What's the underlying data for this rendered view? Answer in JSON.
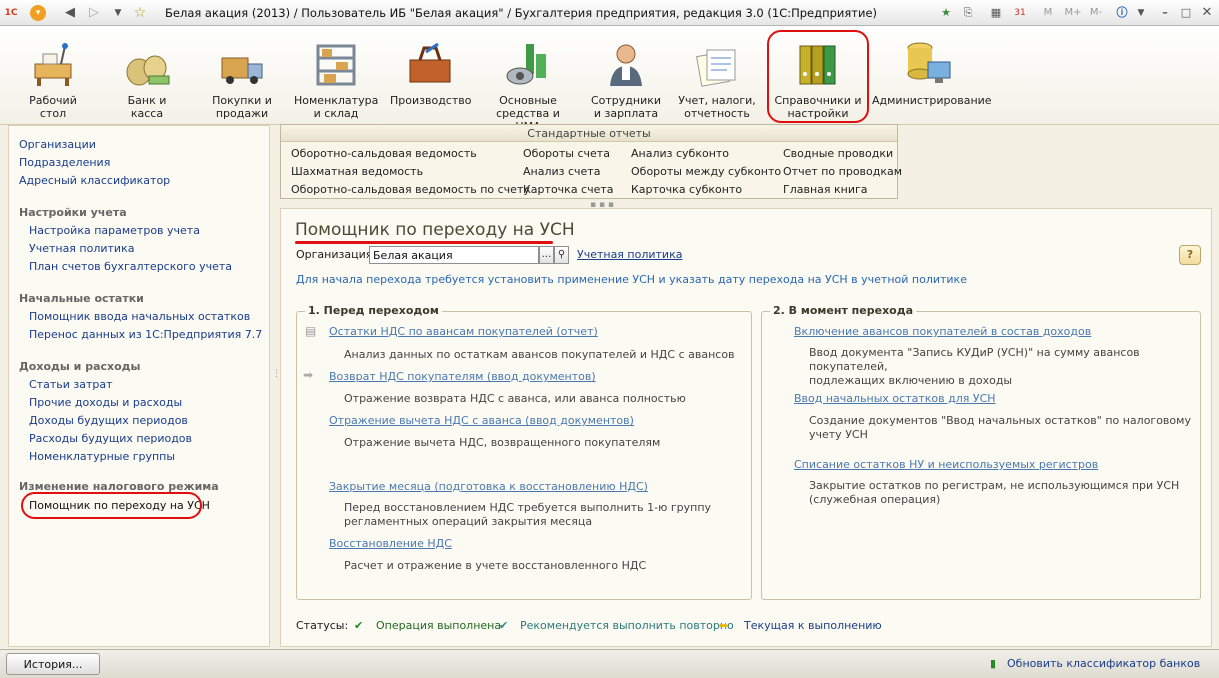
{
  "window": {
    "title": "Белая акация (2013) / Пользователь ИБ \"Белая акация\" / Бухгалтерия предприятия, редакция 3.0  (1С:Предприятие)",
    "tb_buttons": [
      "M",
      "M+",
      "M-"
    ]
  },
  "sections": [
    {
      "label": "Рабочий\nстол",
      "icon": "desk-icon"
    },
    {
      "label": "Банк и\nкасса",
      "icon": "money-bags-icon"
    },
    {
      "label": "Покупки и\nпродажи",
      "icon": "truck-icon"
    },
    {
      "label": "Номенклатура\nи склад",
      "icon": "shelves-icon"
    },
    {
      "label": "Производство",
      "icon": "toolbox-icon"
    },
    {
      "label": "Основные\nсредства и НМА",
      "icon": "factory-icon"
    },
    {
      "label": "Сотрудники\nи зарплата",
      "icon": "employee-icon"
    },
    {
      "label": "Учет, налоги,\nотчетность",
      "icon": "papers-icon"
    },
    {
      "label": "Справочники и\nнастройки учета",
      "icon": "binders-icon"
    },
    {
      "label": "Администрирование",
      "icon": "database-computer-icon"
    }
  ],
  "nav": {
    "top_links": [
      "Организации",
      "Подразделения",
      "Адресный классификатор"
    ],
    "groups": [
      {
        "title": "Настройки учета",
        "items": [
          "Настройка параметров учета",
          "Учетная политика",
          "План счетов бухгалтерского учета"
        ]
      },
      {
        "title": "Начальные остатки",
        "items": [
          "Помощник ввода начальных остатков",
          "Перенос данных из 1С:Предприятия 7.7"
        ]
      },
      {
        "title": "Доходы и расходы",
        "items": [
          "Статьи затрат",
          "Прочие доходы и расходы",
          "Доходы будущих периодов",
          "Расходы будущих периодов",
          "Номенклатурные группы"
        ]
      },
      {
        "title": "Изменение налогового режима",
        "items": [
          "Помощник по переходу на УСН"
        ]
      }
    ]
  },
  "reports": {
    "title": "Стандартные отчеты",
    "columns": [
      [
        "Оборотно-сальдовая ведомость",
        "Шахматная ведомость",
        "Оборотно-сальдовая ведомость по счету"
      ],
      [
        "Обороты счета",
        "Анализ счета",
        "Карточка счета"
      ],
      [
        "Анализ субконто",
        "Обороты между субконто",
        "Карточка субконто"
      ],
      [
        "Сводные проводки",
        "Отчет по проводкам",
        "Главная книга"
      ]
    ]
  },
  "form": {
    "title": "Помощник по переходу на УСН",
    "org_label": "Организация:",
    "org_value": "Белая акация",
    "policy_link": "Учетная политика",
    "hint": "Для начала перехода требуется установить применение УСН и указать дату перехода на УСН в учетной политике",
    "group1": {
      "title": "1. Перед переходом",
      "steps": [
        {
          "link": "Остатки НДС по авансам покупателей (отчет)",
          "desc": "Анализ данных по остаткам авансов покупателей и НДС с авансов"
        },
        {
          "link": "Возврат НДС покупателям (ввод документов)",
          "desc": "Отражение возврата НДС с аванса, или аванса полностью"
        },
        {
          "link": "Отражение вычета НДС с аванса (ввод документов)",
          "desc": "Отражение вычета НДС, возвращенного покупателям"
        },
        {
          "link": "Закрытие месяца (подготовка к восстановлению НДС)",
          "desc": "Перед восстановлением НДС требуется выполнить 1-ю группу\nрегламентных операций закрытия месяца"
        },
        {
          "link": "Восстановление НДС",
          "desc": "Расчет и отражение в учете восстановленного НДС"
        }
      ]
    },
    "group2": {
      "title": "2. В момент перехода",
      "steps": [
        {
          "link": "Включение авансов покупателей в состав доходов",
          "desc": "Ввод документа \"Запись КУДиР (УСН)\" на сумму авансов покупателей,\nподлежащих включению в доходы"
        },
        {
          "link": "Ввод начальных остатков для УСН",
          "desc": "Создание документов \"Ввод начальных остатков\" по налоговому учету УСН"
        },
        {
          "link": "Списание остатков НУ и неиспользуемых регистров",
          "desc": "Закрытие остатков по  регистрам, не использующимся при УСН\n(служебная операция)"
        }
      ]
    },
    "statuses": {
      "label": "Статусы:",
      "done": "Операция выполнена",
      "repeat": "Рекомендуется выполнить повторно",
      "current": "Текущая к выполнению"
    }
  },
  "footer": {
    "history_btn": "История...",
    "update_link": "Обновить классификатор банков"
  },
  "colors": {
    "accent_red": "#e01010",
    "link_blue": "#1a3c8c",
    "done_green": "#1f8a1f",
    "repeat_teal": "#2a8a8a",
    "current_yellow": "#e8b800"
  }
}
